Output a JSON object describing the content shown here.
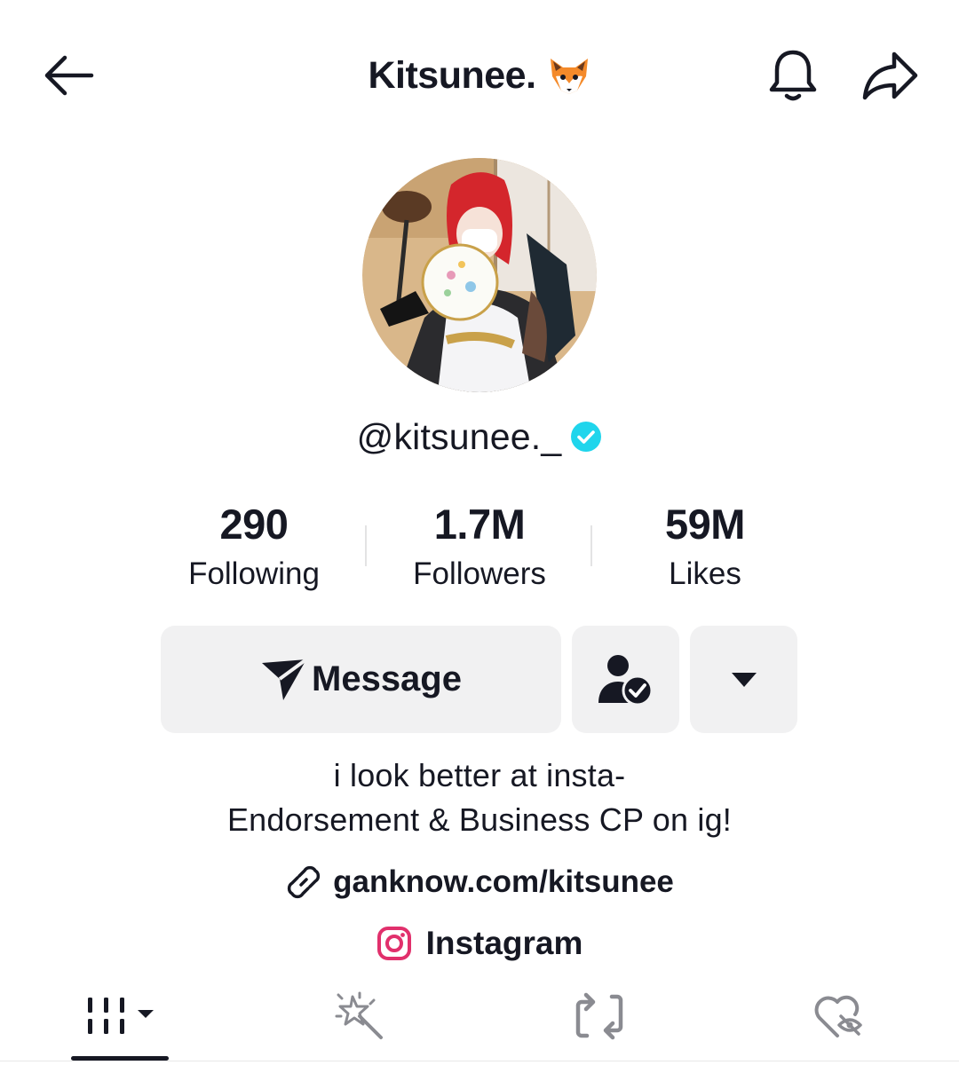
{
  "header": {
    "title": "Kitsunee.",
    "title_emoji_icon": "fox-face-icon",
    "back_icon": "back-arrow-icon",
    "bell_icon": "bell-icon",
    "share_icon": "share-icon"
  },
  "profile": {
    "username": "@kitsunee._",
    "verified_icon": "verified-badge-icon",
    "verified_color": "#20D5EC"
  },
  "stats": [
    {
      "value": "290",
      "label": "Following"
    },
    {
      "value": "1.7M",
      "label": "Followers"
    },
    {
      "value": "59M",
      "label": "Likes"
    }
  ],
  "actions": {
    "message_label": "Message",
    "message_icon": "send-icon",
    "friend_icon": "user-check-icon",
    "more_icon": "caret-down-icon"
  },
  "bio": {
    "line1": "i look better at insta-",
    "line2": "Endorsement & Business CP on ig!"
  },
  "links": {
    "website": "ganknow.com/kitsunee",
    "website_icon": "link-icon",
    "instagram": "Instagram",
    "instagram_icon": "instagram-icon",
    "instagram_color": "#E1306C"
  },
  "tabs": [
    {
      "name": "videos",
      "icon": "grid-bars-icon",
      "selected": true
    },
    {
      "name": "effects",
      "icon": "magic-wand-icon",
      "selected": false
    },
    {
      "name": "reposts",
      "icon": "repost-icon",
      "selected": false
    },
    {
      "name": "liked",
      "icon": "hidden-heart-icon",
      "selected": false
    }
  ]
}
